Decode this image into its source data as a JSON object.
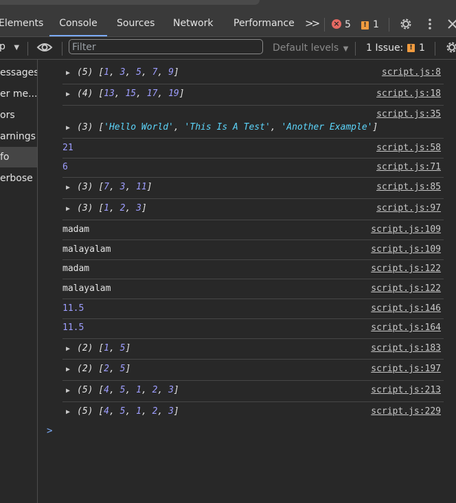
{
  "tabs": {
    "elements": "Elements",
    "console": "Console",
    "sources": "Sources",
    "network": "Network",
    "performance": "Performance",
    "more": ">>"
  },
  "badges": {
    "errors": "5",
    "warnings": "1"
  },
  "toolbar": {
    "context": "p",
    "filter_placeholder": "Filter",
    "levels": "Default levels",
    "issues_label": "1 Issue:",
    "issues_count": "1"
  },
  "sidebar": {
    "items": [
      {
        "label": "essages"
      },
      {
        "label": "er me..."
      },
      {
        "label": "ors"
      },
      {
        "label": "arnings"
      },
      {
        "label": "fo"
      },
      {
        "label": "erbose"
      }
    ]
  },
  "console": {
    "rows": [
      {
        "kind": "array",
        "count": "(5)",
        "items": [
          "1",
          "3",
          "5",
          "7",
          "9"
        ],
        "src": "script.js:8"
      },
      {
        "kind": "array",
        "count": "(4)",
        "items": [
          "13",
          "15",
          "17",
          "19"
        ],
        "src": "script.js:18"
      },
      {
        "kind": "strarray",
        "count": "(3)",
        "items": [
          "'Hello World'",
          "'This Is A Test'",
          "'Another Example'"
        ],
        "src": "script.js:35"
      },
      {
        "kind": "num",
        "text": "21",
        "src": "script.js:58"
      },
      {
        "kind": "num",
        "text": "6",
        "src": "script.js:71"
      },
      {
        "kind": "array",
        "count": "(3)",
        "items": [
          "7",
          "3",
          "11"
        ],
        "src": "script.js:85"
      },
      {
        "kind": "array",
        "count": "(3)",
        "items": [
          "1",
          "2",
          "3"
        ],
        "src": "script.js:97"
      },
      {
        "kind": "text",
        "text": "madam",
        "src": "script.js:109"
      },
      {
        "kind": "text",
        "text": "malayalam",
        "src": "script.js:109"
      },
      {
        "kind": "text",
        "text": "madam",
        "src": "script.js:122"
      },
      {
        "kind": "text",
        "text": "malayalam",
        "src": "script.js:122"
      },
      {
        "kind": "num",
        "text": "11.5",
        "src": "script.js:146"
      },
      {
        "kind": "num",
        "text": "11.5",
        "src": "script.js:164"
      },
      {
        "kind": "array",
        "count": "(2)",
        "items": [
          "1",
          "5"
        ],
        "src": "script.js:183"
      },
      {
        "kind": "array",
        "count": "(2)",
        "items": [
          "2",
          "5"
        ],
        "src": "script.js:197"
      },
      {
        "kind": "array",
        "count": "(5)",
        "items": [
          "4",
          "5",
          "1",
          "2",
          "3"
        ],
        "src": "script.js:213"
      },
      {
        "kind": "array",
        "count": "(5)",
        "items": [
          "4",
          "5",
          "1",
          "2",
          "3"
        ],
        "src": "script.js:229"
      }
    ],
    "prompt": ">"
  },
  "colors": {
    "background": "#282828",
    "accent": "#7cacf8",
    "number": "#9e9eff",
    "string": "#5cd5fb",
    "error": "#e46962",
    "warning": "#f09b3f"
  }
}
